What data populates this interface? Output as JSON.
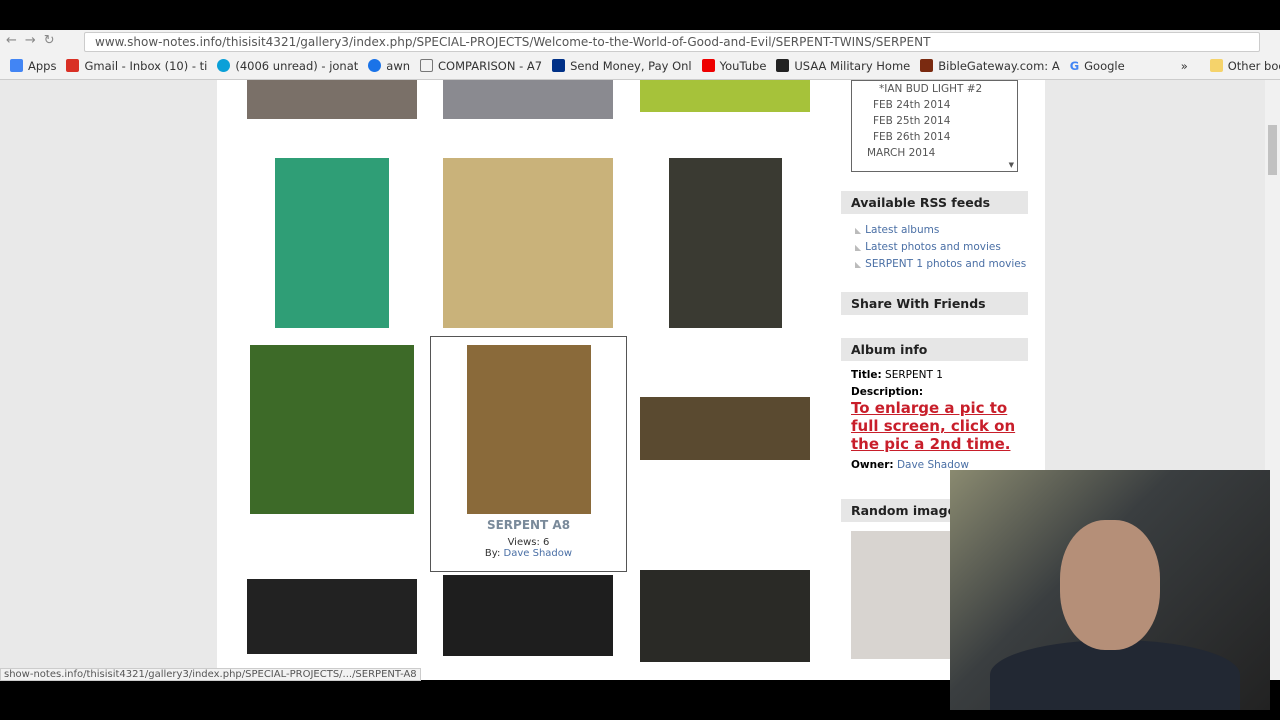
{
  "browser": {
    "url": "www.show-notes.info/thisisit4321/gallery3/index.php/SPECIAL-PROJECTS/Welcome-to-the-World-of-Good-and-Evil/SERPENT-TWINS/SERPENT",
    "bookmarks": [
      {
        "label": "Apps",
        "color": "#4285f4"
      },
      {
        "label": "Gmail - Inbox (10) - ti",
        "color": "#d93025"
      },
      {
        "label": "(4006 unread) - jonat",
        "color": "#0aa0d8"
      },
      {
        "label": "awn",
        "color": "#1a73e8"
      },
      {
        "label": "COMPARISON - A7",
        "color": "#fff"
      },
      {
        "label": "Send Money, Pay Onl",
        "color": "#003087"
      },
      {
        "label": "YouTube",
        "color": "#e00"
      },
      {
        "label": "USAA Military Home",
        "color": "#222"
      },
      {
        "label": "BibleGateway.com: A",
        "color": "#7a2a10"
      },
      {
        "label": "Google",
        "color": "#34a853"
      }
    ],
    "other_bookmarks": "Other bookmarks",
    "more": "»"
  },
  "tree": {
    "items": [
      "*IAN BUD LIGHT #2",
      "FEB 24th 2014",
      "FEB 25th 2014",
      "FEB 26th 2014",
      "MARCH 2014"
    ]
  },
  "rss": {
    "title": "Available RSS feeds",
    "items": [
      "Latest albums",
      "Latest photos and movies",
      "SERPENT 1 photos and movies"
    ]
  },
  "share": {
    "title": "Share With Friends"
  },
  "album": {
    "title": "Album info",
    "title_label": "Title:",
    "title_value": "SERPENT 1",
    "desc_label": "Description:",
    "desc_value": "To enlarge a pic to full screen, click on the pic a 2nd time.",
    "owner_label": "Owner:",
    "owner_value": "Dave Shadow"
  },
  "random": {
    "title": "Random image"
  },
  "selected": {
    "name": "SERPENT A8",
    "views": "Views: 6",
    "by": "By:",
    "owner": "Dave Shadow"
  },
  "status": "show-notes.info/thisisit4321/gallery3/index.php/SPECIAL-PROJECTS/.../SERPENT-A8"
}
